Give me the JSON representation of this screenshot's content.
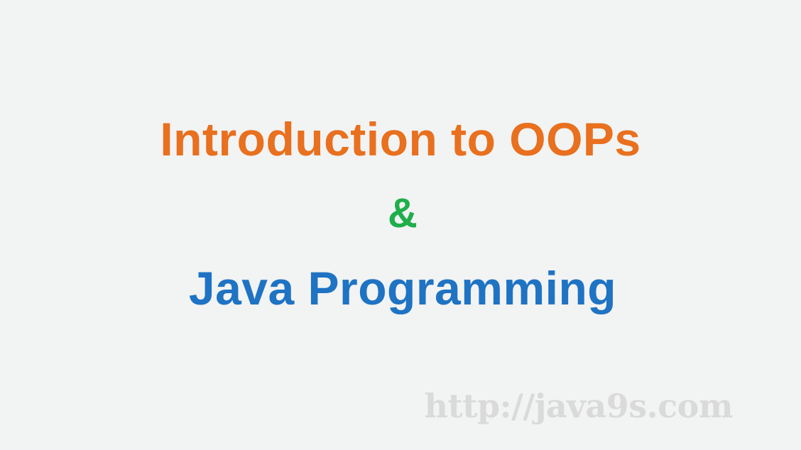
{
  "slide": {
    "title": "Introduction to OOPs",
    "ampersand": "&",
    "subtitle": "Java Programming",
    "watermark": "http://java9s.com"
  },
  "colors": {
    "background": "#f2f3f3",
    "title": "#e8701e",
    "ampersand": "#1fae4b",
    "subtitle": "#1f73c3",
    "watermark": "#d9dad9"
  }
}
